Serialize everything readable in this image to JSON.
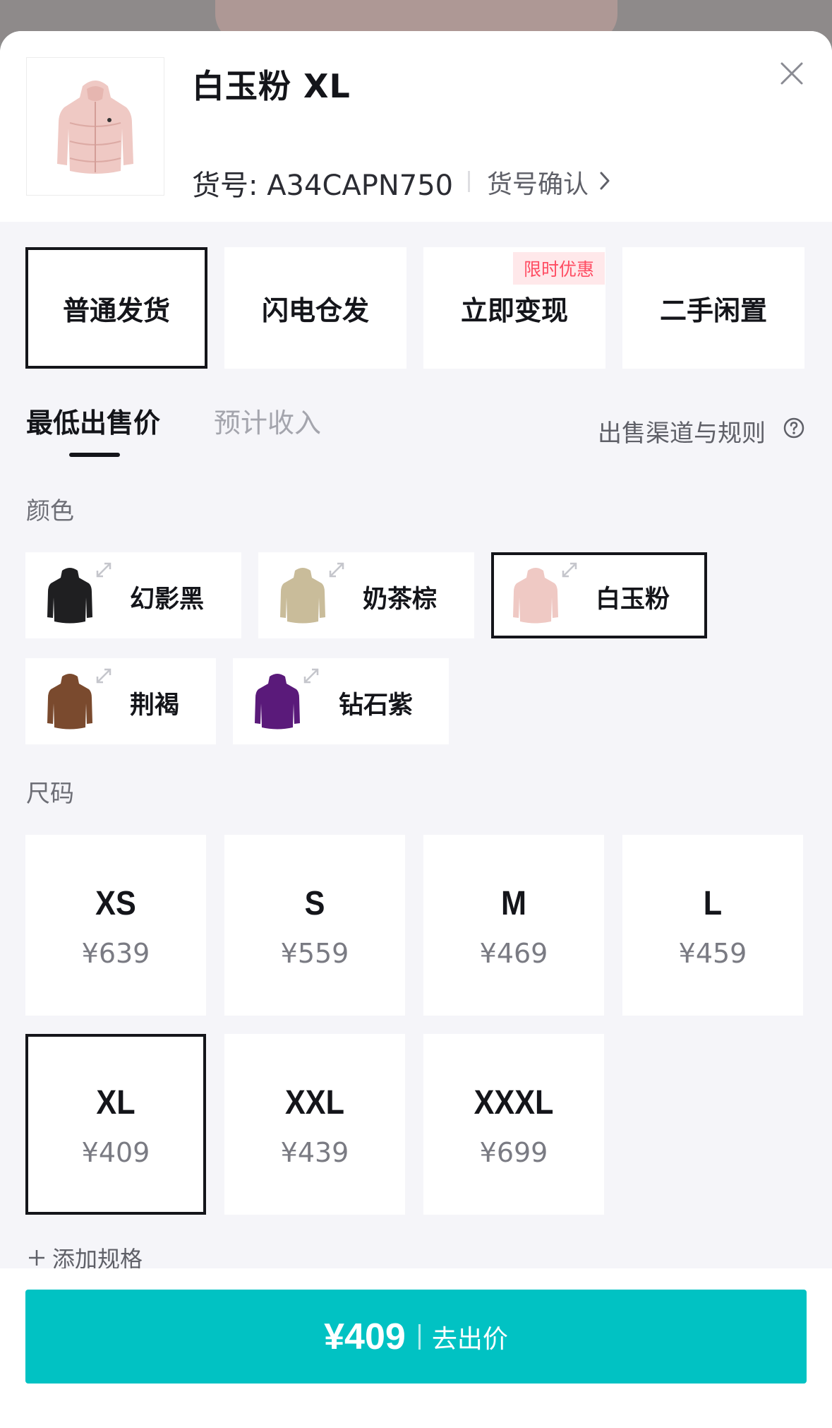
{
  "header": {
    "title": "白玉粉 XL",
    "article_no": "货号: A34CAPN750",
    "article_confirm": "货号确认"
  },
  "shipping_options": [
    {
      "label": "普通发货",
      "selected": true
    },
    {
      "label": "闪电仓发",
      "selected": false
    },
    {
      "label": "立即变现",
      "selected": false,
      "badge": "限时优惠"
    },
    {
      "label": "二手闲置",
      "selected": false
    }
  ],
  "tabs": [
    {
      "label": "最低出售价",
      "active": true
    },
    {
      "label": "预计收入",
      "active": false
    }
  ],
  "rules_link": "出售渠道与规则",
  "color_section": {
    "label": "颜色",
    "options": [
      {
        "name": "幻影黑",
        "color": "#1f1f21",
        "selected": false
      },
      {
        "name": "奶茶棕",
        "color": "#c9bc9a",
        "selected": false
      },
      {
        "name": "白玉粉",
        "color": "#efc9c4",
        "selected": true
      },
      {
        "name": "荆褐",
        "color": "#7a4a2e",
        "selected": false
      },
      {
        "name": "钻石紫",
        "color": "#5a1a7a",
        "selected": false
      }
    ]
  },
  "size_section": {
    "label": "尺码",
    "options": [
      {
        "size": "XS",
        "price": "¥639",
        "selected": false
      },
      {
        "size": "S",
        "price": "¥559",
        "selected": false
      },
      {
        "size": "M",
        "price": "¥469",
        "selected": false
      },
      {
        "size": "L",
        "price": "¥459",
        "selected": false
      },
      {
        "size": "XL",
        "price": "¥409",
        "selected": true
      },
      {
        "size": "XXL",
        "price": "¥439",
        "selected": false
      },
      {
        "size": "XXXL",
        "price": "¥699",
        "selected": false
      }
    ],
    "add_spec": "添加规格"
  },
  "cta": {
    "price": "¥409",
    "action": "去出价",
    "color": "#01c2c3"
  },
  "icons": [
    "close-icon",
    "chevron-right-icon",
    "help-circle-icon",
    "expand-icon",
    "plus-icon"
  ]
}
